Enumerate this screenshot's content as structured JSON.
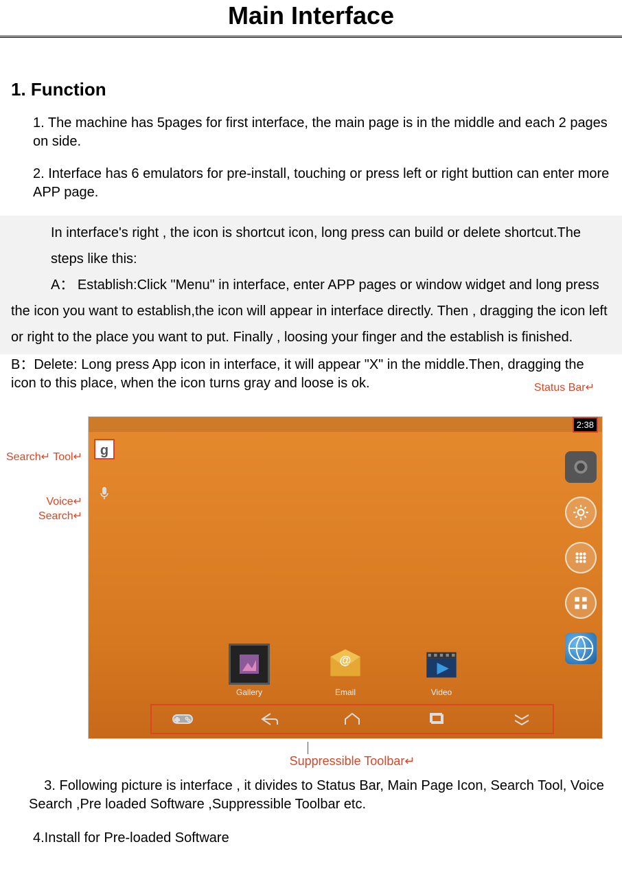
{
  "main_title": "Main Interface",
  "section1_title": "1. Function",
  "function_item1": "1. The machine has 5pages for first interface, the main page is in the middle and each 2 pages on side.",
  "function_item2": "2. Interface has 6 emulators for pre-install, touching or press left or right buttion can enter more APP page.",
  "highlight_intro": "In interface's right , the icon is shortcut icon, long press can build or delete shortcut.The steps like this:",
  "highlight_a": "A：  Establish:Click \"Menu\" in interface, enter APP pages or window widget and long press the icon you want to establish,the icon will appear in interface directly. Then , dragging the icon left or right to the place you want to put. Finally , loosing your finger and the establish is finished.",
  "para_b": "B：Delete: Long press App icon in interface, it will appear \"X\" in the middle.Then, dragging the icon to this place, when the icon turns gray and loose is ok.",
  "annot_status_bar": "Status Bar↵",
  "annot_search_tool": "Search↵ Tool↵",
  "annot_voice_search": "Voice↵ Search↵",
  "annot_suppressible": "Suppressible Toolbar↵",
  "status_time": "2:38",
  "search_g": "g",
  "dock": {
    "gallery": "Gallery",
    "email": "Email",
    "video": "Video"
  },
  "para_3": "3. Following picture is interface , it divides to Status Bar, Main Page Icon, Search Tool, Voice Search ,Pre loaded Software ,Suppressible Toolbar etc.",
  "para_4": "4.Install for Pre-loaded Software"
}
